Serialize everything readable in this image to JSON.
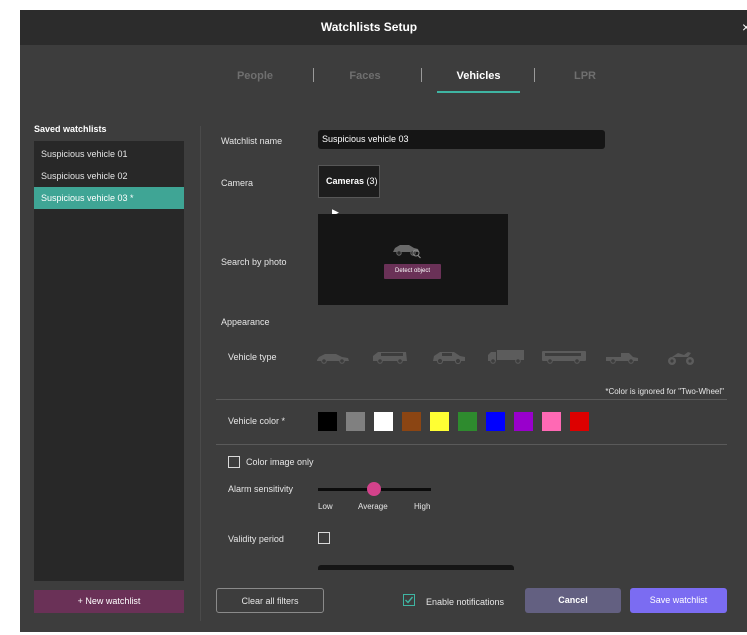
{
  "window": {
    "title": "Watchlists Setup",
    "close_glyph": "×"
  },
  "tabs": [
    {
      "label": "People",
      "active": false
    },
    {
      "label": "Faces",
      "active": false
    },
    {
      "label": "Vehicles",
      "active": true
    },
    {
      "label": "LPR",
      "active": false
    }
  ],
  "sidebar": {
    "label": "Saved watchlists",
    "items": [
      {
        "label": "Suspicious vehicle 01"
      },
      {
        "label": "Suspicious vehicle 02"
      },
      {
        "label": "Suspicious vehicle 03 *",
        "selected": true
      }
    ],
    "new_button": {
      "icon": "plus-icon",
      "label": "+ New watchlist"
    }
  },
  "form": {
    "watchlist_name": {
      "label": "Watchlist name",
      "value": "Suspicious vehicle 03"
    },
    "camera": {
      "label": "Camera",
      "button_label": "Cameras",
      "count": "(3)",
      "arrow": "▶"
    },
    "search_by_photo": {
      "label": "Search by photo",
      "button": "Detect object"
    },
    "appearance": {
      "label": "Appearance"
    },
    "vehicle_type": {
      "label": "Vehicle type",
      "types": [
        "sedan-icon",
        "van-icon",
        "suv-icon",
        "truck-icon",
        "bus-icon",
        "pickup-icon",
        "motorcycle-icon"
      ]
    },
    "color_note": "*Color is ignored for \"Two-Wheel\"",
    "vehicle_color": {
      "label": "Vehicle color *",
      "swatches": [
        "#000000",
        "#808080",
        "#ffffff",
        "#8b4513",
        "#ffff33",
        "#2e8b2e",
        "#0000ff",
        "#9900cc",
        "#ff69b4",
        "#dd0000"
      ]
    },
    "color_image_only": {
      "label": "Color image only",
      "checked": false
    },
    "alarm_sensitivity": {
      "label": "Alarm sensitivity",
      "value": 0.5,
      "ticks": [
        "Low",
        "Average",
        "High"
      ]
    },
    "validity_period": {
      "label": "Validity period",
      "checked": false
    }
  },
  "footer": {
    "clear_filters": "Clear all filters",
    "enable_notifications": {
      "label": "Enable notifications",
      "checked": true
    },
    "cancel": "Cancel",
    "save": "Save watchlist"
  },
  "colors": {
    "accent_teal": "#3fb5a3",
    "selected_item": "#3fa595",
    "magenta_button": "#6a3157",
    "save_button": "#7b6cf2",
    "cancel_button": "#636081",
    "slider_thumb": "#d3428b"
  }
}
